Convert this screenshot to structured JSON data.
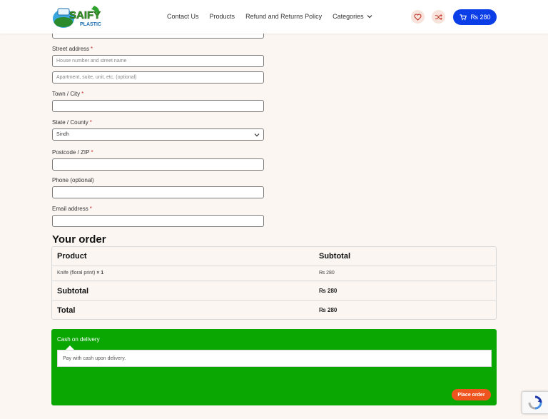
{
  "header": {
    "logo_text": "SAIFY",
    "logo_subtext": "PLASTIC",
    "nav": [
      {
        "label": "Contact Us"
      },
      {
        "label": "Products"
      },
      {
        "label": "Refund and Returns Policy"
      },
      {
        "label": "Categories"
      }
    ],
    "cart_amount": "₨ 280"
  },
  "form": {
    "street_label": "Street address",
    "street_placeholder": "House number and street name",
    "apartment_placeholder": "Apartment, suite, unit, etc. (optional)",
    "town_label": "Town / City",
    "state_label": "State / County",
    "state_value": "Sindh",
    "postcode_label": "Postcode / ZIP",
    "phone_label": "Phone (optional)",
    "email_label": "Email address",
    "required_mark": "*"
  },
  "order": {
    "title": "Your order",
    "col_product": "Product",
    "col_subtotal": "Subtotal",
    "items": [
      {
        "name": "Knife (floral print)",
        "qty": "× 1",
        "price": "₨ 280"
      }
    ],
    "subtotal_label": "Subtotal",
    "subtotal_value": "₨ 280",
    "total_label": "Total",
    "total_value": "₨ 280"
  },
  "payment": {
    "method": "Cash on delivery",
    "description": "Pay with cash upon delivery.",
    "place_order": "Place order"
  },
  "colors": {
    "brand_blue": "#0b3ee6",
    "payment_green": "#0aa703",
    "place_order_orange": "#f0541e",
    "background": "#fcf6f2"
  },
  "icons": [
    "heart-icon",
    "shuffle-icon",
    "cart-icon",
    "chevron-down-icon",
    "recaptcha-icon"
  ]
}
